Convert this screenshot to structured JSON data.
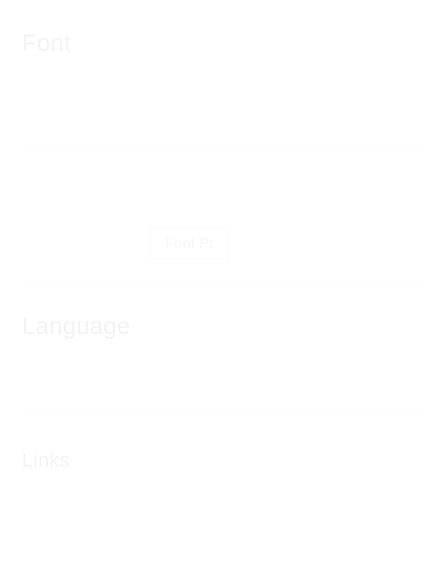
{
  "sections": {
    "first": {
      "title": "Font"
    },
    "action": {
      "label": "Font Pr"
    },
    "second": {
      "title": "Language"
    },
    "third": {
      "title": "Links"
    }
  }
}
